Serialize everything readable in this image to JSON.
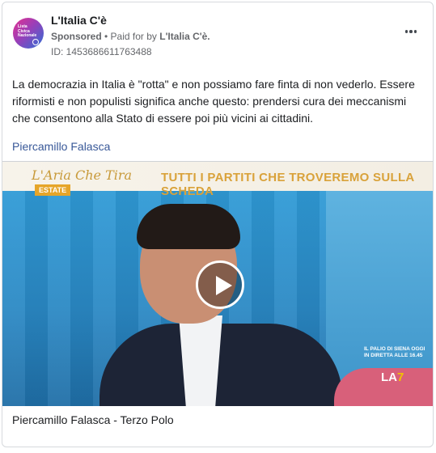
{
  "page": {
    "name": "L'Italia C'è",
    "avatar_text": "Lista Civica Nazionale",
    "sponsored_label": "Sponsored",
    "paid_for_prefix": " • Paid for by ",
    "paid_for_by": "L'Italia C'è.",
    "ad_id": "ID: 1453686611763488"
  },
  "post": {
    "text": "La democrazia in Italia è \"rotta\" e non possiamo fare finta di non vederlo. Essere riformisti e non populisti significa anche questo: prendersi cura dei meccanismi che consentono alla Stato di essere poi più vicini ai cittadini.",
    "author_link": "Piercamillo Falasca"
  },
  "video": {
    "banner_logo": "L'Aria Che Tira",
    "banner_estate": "ESTATE",
    "banner_title": "TUTTI I PARTITI CHE TROVEREMO SULLA SCHEDA",
    "overlay_text": "IL PALIO DI SIENA OGGI IN DIRETTA ALLE 16.45",
    "channel_logo_main": "LA",
    "channel_logo_num": "7",
    "caption": "Piercamillo Falasca - Terzo Polo"
  },
  "icons": {
    "more": "more-horizontal-icon",
    "play": "play-icon"
  },
  "colors": {
    "link": "#385898",
    "meta": "#65676b",
    "banner_title": "#d9a23a"
  }
}
